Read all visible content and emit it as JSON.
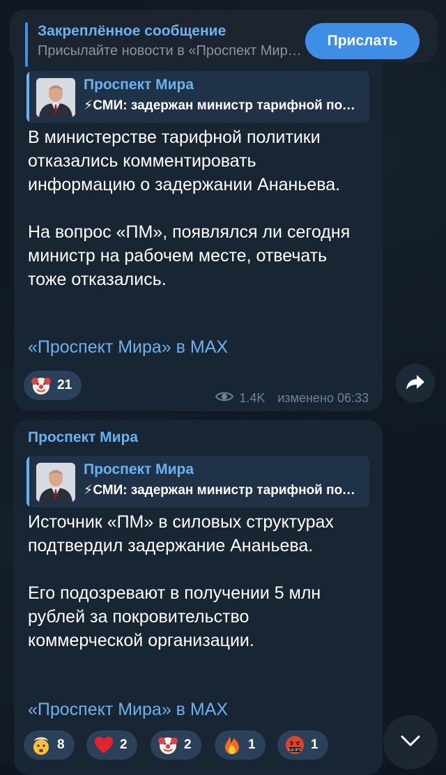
{
  "pinned": {
    "title": "Закреплённое сообщение",
    "subtitle": "Присылайте новости в «Проспект Мира»",
    "button_label": "Прислать"
  },
  "message1": {
    "reply": {
      "name": "Проспект Мира",
      "text": "⚡СМИ: задержан министр тарифной политики"
    },
    "text": "В министерстве тарифной политики отказались комментировать информацию о задержании Ананьева.\n\nНа вопрос «ПМ», появлялся ли сегодня министр на рабочем месте, отвечать тоже отказались.",
    "link": "«Проспект Мира» в MAX",
    "reactions": [
      {
        "icon": "clown-face-icon",
        "count": "21"
      }
    ],
    "views": "1.4K",
    "status": "изменено 06:33"
  },
  "message2": {
    "sender": "Проспект Мира",
    "reply": {
      "name": "Проспект Мира",
      "text": "⚡СМИ: задержан министр тарифной политики"
    },
    "text": "Источник «ПМ» в силовых структурах подтвердил задержание Ананьева.\n\nЕго подозревают в получении 5 млн рублей за покровительство коммерческой организации.",
    "link": "«Проспект Мира» в MAX",
    "reactions": [
      {
        "icon": "exploding-head-icon",
        "count": "8"
      },
      {
        "icon": "red-heart-icon",
        "count": "2"
      },
      {
        "icon": "clown-face-icon",
        "count": "2"
      },
      {
        "icon": "fire-icon",
        "count": "1"
      },
      {
        "icon": "cursing-face-icon",
        "label": "&$!#%",
        "count": "1"
      }
    ]
  },
  "colors": {
    "accent": "#6ab3f3",
    "bubble": "#182533",
    "reaction_bg": "#2b4159",
    "send_button": "#3e8ee6"
  }
}
